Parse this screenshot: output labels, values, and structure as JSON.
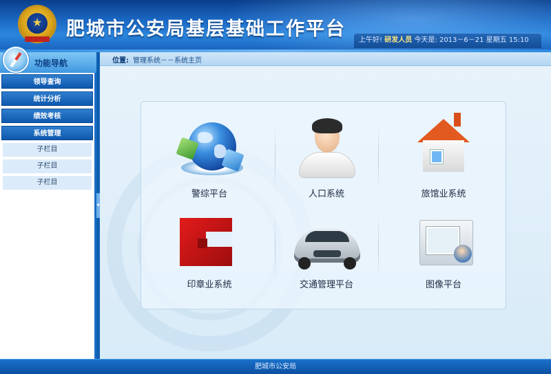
{
  "header": {
    "title": "肥城市公安局基层基础工作平台",
    "emblem_icon": "police-emblem-icon",
    "greeting": "上午好!",
    "user": "研发人员",
    "date_label": "今天是:",
    "date": "2013－6－21",
    "weekday": "星期五",
    "time": "15:10"
  },
  "sidebar": {
    "title": "功能导航",
    "menu": [
      {
        "label": "领导查询"
      },
      {
        "label": "统计分析"
      },
      {
        "label": "绩效考核"
      },
      {
        "label": "系统管理"
      }
    ],
    "sub_items": [
      {
        "label": "子栏目"
      },
      {
        "label": "子栏目"
      },
      {
        "label": "子栏目"
      }
    ]
  },
  "breadcrumb": {
    "label": "位置:",
    "path": "管理系统－－系统主页"
  },
  "tiles": [
    {
      "label": "警综平台",
      "icon": "globe-icon"
    },
    {
      "label": "人口系统",
      "icon": "person-icon"
    },
    {
      "label": "旅馆业系统",
      "icon": "house-icon"
    },
    {
      "label": "印章业系统",
      "icon": "red-block-icon"
    },
    {
      "label": "交通管理平台",
      "icon": "car-icon"
    },
    {
      "label": "图像平台",
      "icon": "image-folder-icon"
    }
  ],
  "footer": {
    "text": "肥城市公安局"
  },
  "colors": {
    "header_blue": "#1c6cc8",
    "menu_blue": "#0f58ad",
    "panel_bg": "#e8f3fb"
  }
}
